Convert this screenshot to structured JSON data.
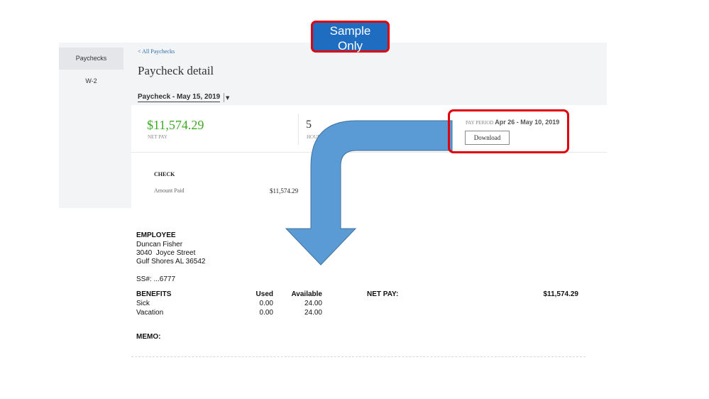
{
  "badge": {
    "line1": "Sample",
    "line2": "Only"
  },
  "sidebar": {
    "items": [
      {
        "label": "Paychecks"
      },
      {
        "label": "W-2"
      }
    ]
  },
  "header": {
    "back_link": "< All Paychecks",
    "title": "Paycheck detail",
    "selected_paycheck": "Paycheck - May 15, 2019"
  },
  "summary": {
    "net_pay_amount": "$11,574.29",
    "net_pay_label": "NET PAY",
    "hours_value": "5",
    "hours_label": "HOURS",
    "pay_period_label": "PAY PERIOD",
    "pay_period_range": "Apr 26 - May 10, 2019",
    "download_label": "Download"
  },
  "check": {
    "heading": "CHECK",
    "amount_paid_label": "Amount Paid",
    "amount_paid_value": "$11,574.29"
  },
  "stub": {
    "employee_heading": "EMPLOYEE",
    "employee_name": "Duncan Fisher",
    "employee_street": "3040  Joyce Street",
    "employee_city": "Gulf Shores AL 36542",
    "ssn": "SS#: ...6777",
    "benefits_heading": "BENEFITS",
    "used_heading": "Used",
    "available_heading": "Available",
    "benefits": [
      {
        "name": "Sick",
        "used": "0.00",
        "available": "24.00"
      },
      {
        "name": "Vacation",
        "used": "0.00",
        "available": "24.00"
      }
    ],
    "net_pay_label": "NET PAY:",
    "net_pay_value": "$11,574.29",
    "memo_label": "MEMO:"
  },
  "colors": {
    "highlight": "#e0000b",
    "badge_fill": "#1f6dc0",
    "arrow": "#5b9bd5",
    "net_pay": "#3caa22"
  }
}
